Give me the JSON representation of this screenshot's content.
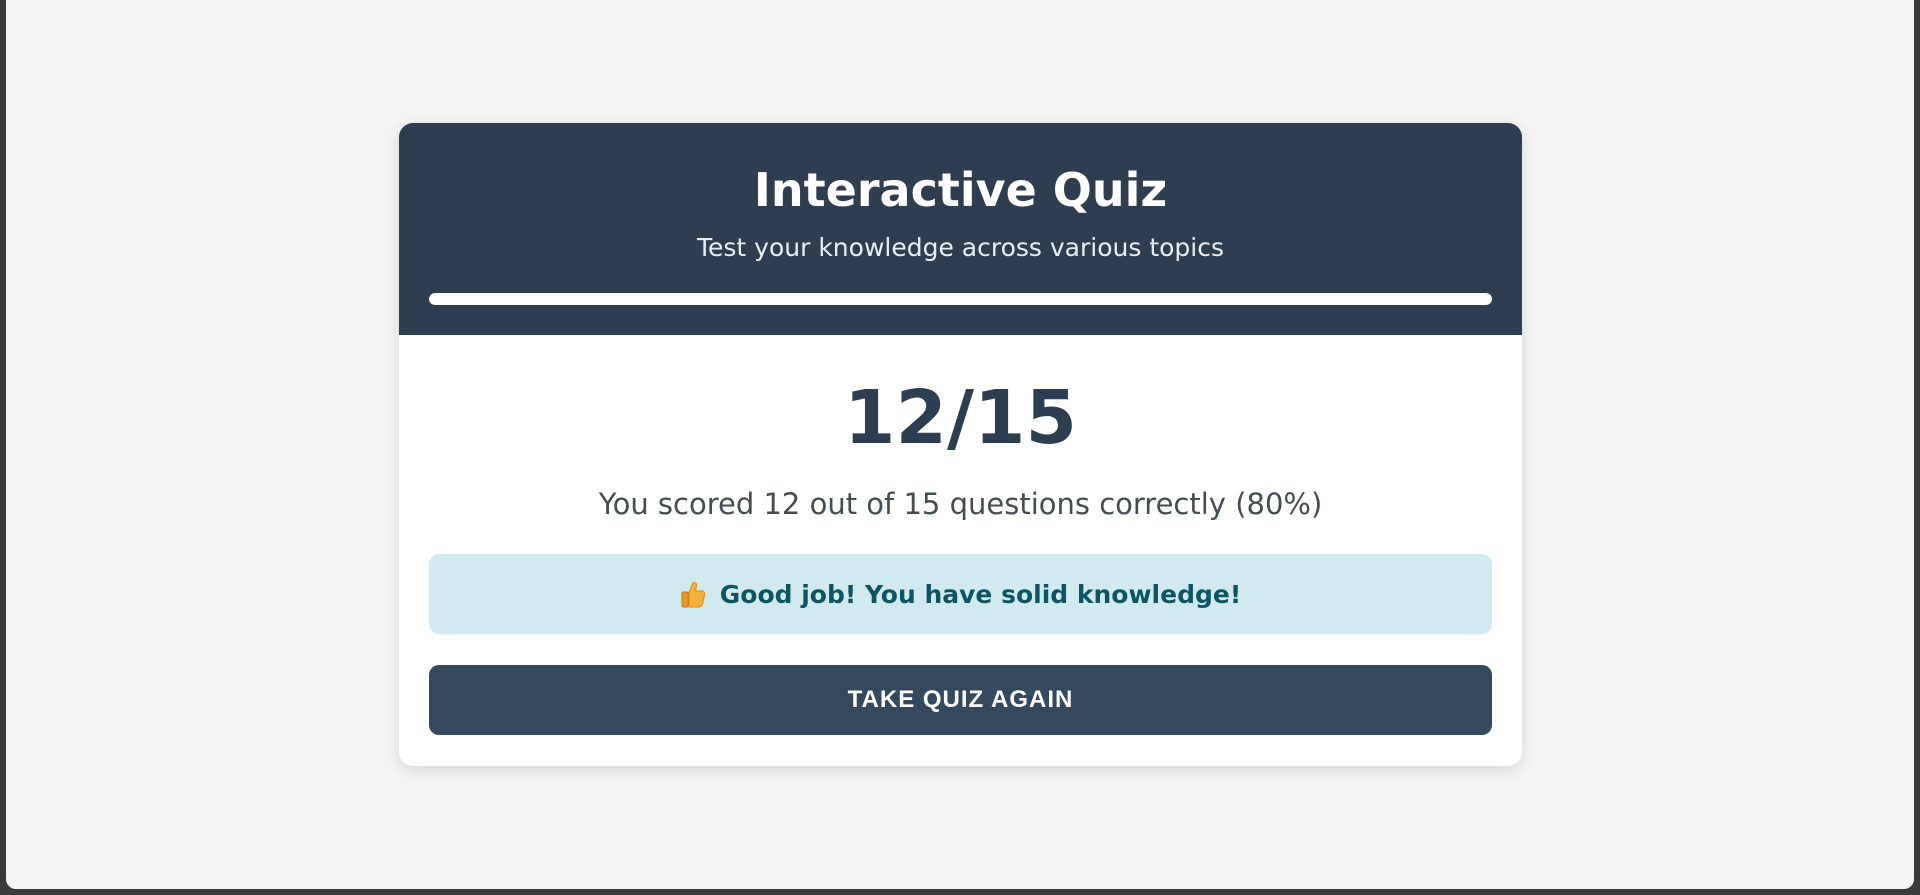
{
  "header": {
    "title": "Interactive Quiz",
    "subtitle": "Test your knowledge across various topics",
    "progress_fraction": 1.0
  },
  "result": {
    "score": "12/15",
    "summary": "You scored 12 out of 15 questions correctly (80%)",
    "feedback_icon": "thumbs-up-icon",
    "feedback": "Good job! You have solid knowledge!"
  },
  "actions": {
    "retake_label": "TAKE QUIZ AGAIN"
  },
  "colors": {
    "header_bg": "#2e3d50",
    "button_bg": "#34495e",
    "feedback_bg": "#d1eaf0",
    "feedback_text": "#0e5563"
  }
}
